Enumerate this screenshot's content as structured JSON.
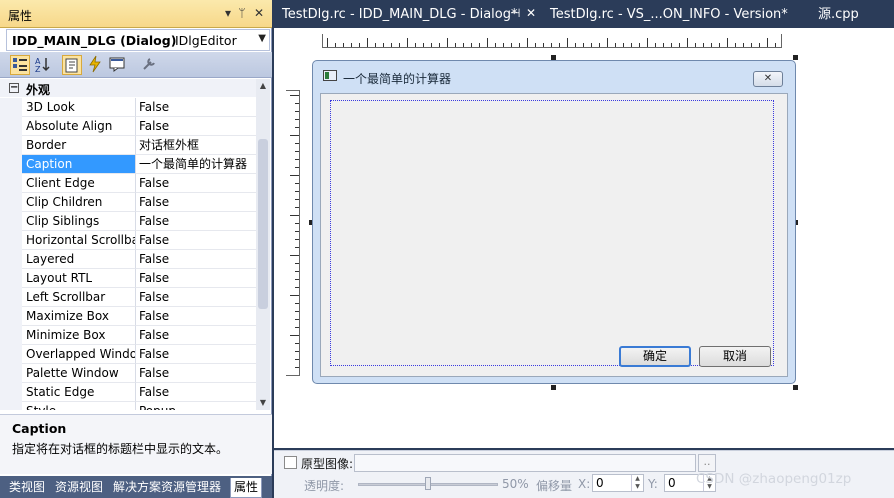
{
  "properties_panel": {
    "title": "属性",
    "title_buttons": {
      "dropdown": "▾",
      "pin": "ᛘ",
      "close": "✕"
    },
    "object": {
      "name": "IDD_MAIN_DLG (Dialog)",
      "type": "IDlgEditor"
    },
    "toolbar_icons": [
      "categorized-icon",
      "alphabetical-icon",
      "properties-icon",
      "events-icon",
      "messages-icon",
      "property-pages-icon"
    ],
    "category": {
      "toggle": "⊟",
      "label": "外观"
    },
    "rows": [
      {
        "name": "3D Look",
        "value": "False"
      },
      {
        "name": "Absolute Align",
        "value": "False"
      },
      {
        "name": "Border",
        "value": "对话框外框"
      },
      {
        "name": "Caption",
        "value": "一个最简单的计算器"
      },
      {
        "name": "Client Edge",
        "value": "False"
      },
      {
        "name": "Clip Children",
        "value": "False"
      },
      {
        "name": "Clip Siblings",
        "value": "False"
      },
      {
        "name": "Horizontal Scrollba",
        "value": "False"
      },
      {
        "name": "Layered",
        "value": "False"
      },
      {
        "name": "Layout RTL",
        "value": "False"
      },
      {
        "name": "Left Scrollbar",
        "value": "False"
      },
      {
        "name": "Maximize Box",
        "value": "False"
      },
      {
        "name": "Minimize Box",
        "value": "False"
      },
      {
        "name": "Overlapped Windo",
        "value": "False"
      },
      {
        "name": "Palette Window",
        "value": "False"
      },
      {
        "name": "Static Edge",
        "value": "False"
      },
      {
        "name": "Style",
        "value": "Popup"
      }
    ],
    "selected_row": "Caption",
    "description": {
      "title": "Caption",
      "text": "指定将在对话框的标题栏中显示的文本。"
    },
    "bottom_tabs": [
      "类视图",
      "资源视图",
      "解决方案资源管理器",
      "属性"
    ],
    "active_bottom_tab": "属性"
  },
  "document_tabs": [
    {
      "label": "TestDlg.rc - IDD_MAIN_DLG - Dialog*",
      "active": true
    },
    {
      "label": "TestDlg.rc - VS_...ON_INFO - Version*",
      "active": false
    },
    {
      "label": "源.cpp",
      "active": false
    }
  ],
  "tab_buttons": {
    "pin": "⊣",
    "close": "✕"
  },
  "dialog": {
    "title": "一个最简单的计算器",
    "close_glyph": "✕",
    "ok_label": "确定",
    "cancel_label": "取消"
  },
  "image_bar": {
    "checkbox_label": "原型图像:",
    "browse_label": "..",
    "transparency_label": "透明度:",
    "transparency_value": "50%",
    "transparency_fraction": 0.5,
    "offset_label": "偏移量",
    "x_label": "X:",
    "x_value": "0",
    "y_label": "Y:",
    "y_value": "0"
  },
  "watermark": "CSDN @zhaopeng01zp",
  "colors": {
    "ide_background": "#2b3c59",
    "panel_title": "#f7d88a",
    "selection": "#3399ff",
    "dialog_frame": "#cfe0f5"
  }
}
